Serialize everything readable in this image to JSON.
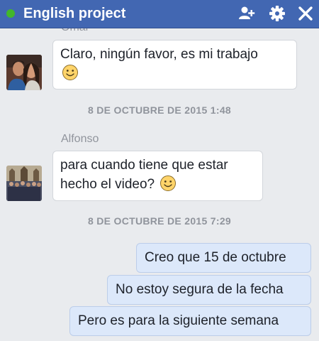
{
  "header": {
    "title": "English project",
    "status": "online",
    "icons": [
      "add-person-icon",
      "gear-icon",
      "close-icon"
    ]
  },
  "messages": {
    "omar_name": "Omar",
    "omar_text": "Claro, ningún favor, es mi trabajo",
    "timestamp_1": "8 DE OCTUBRE DE 2015 1:48",
    "alfonso_name": "Alfonso",
    "alfonso_line1": "para cuando tiene que estar",
    "alfonso_line2": "hecho el video?",
    "timestamp_2": "8 DE OCTUBRE DE 2015 7:29",
    "me_1": "Creo que 15 de octubre",
    "me_2": "No estoy segura de la fecha",
    "me_3": "Pero es para la siguiente semana"
  },
  "colors": {
    "header": "#4267b2",
    "online": "#42b72a",
    "background": "#e9ebee",
    "own_bubble": "#dce8fa"
  }
}
